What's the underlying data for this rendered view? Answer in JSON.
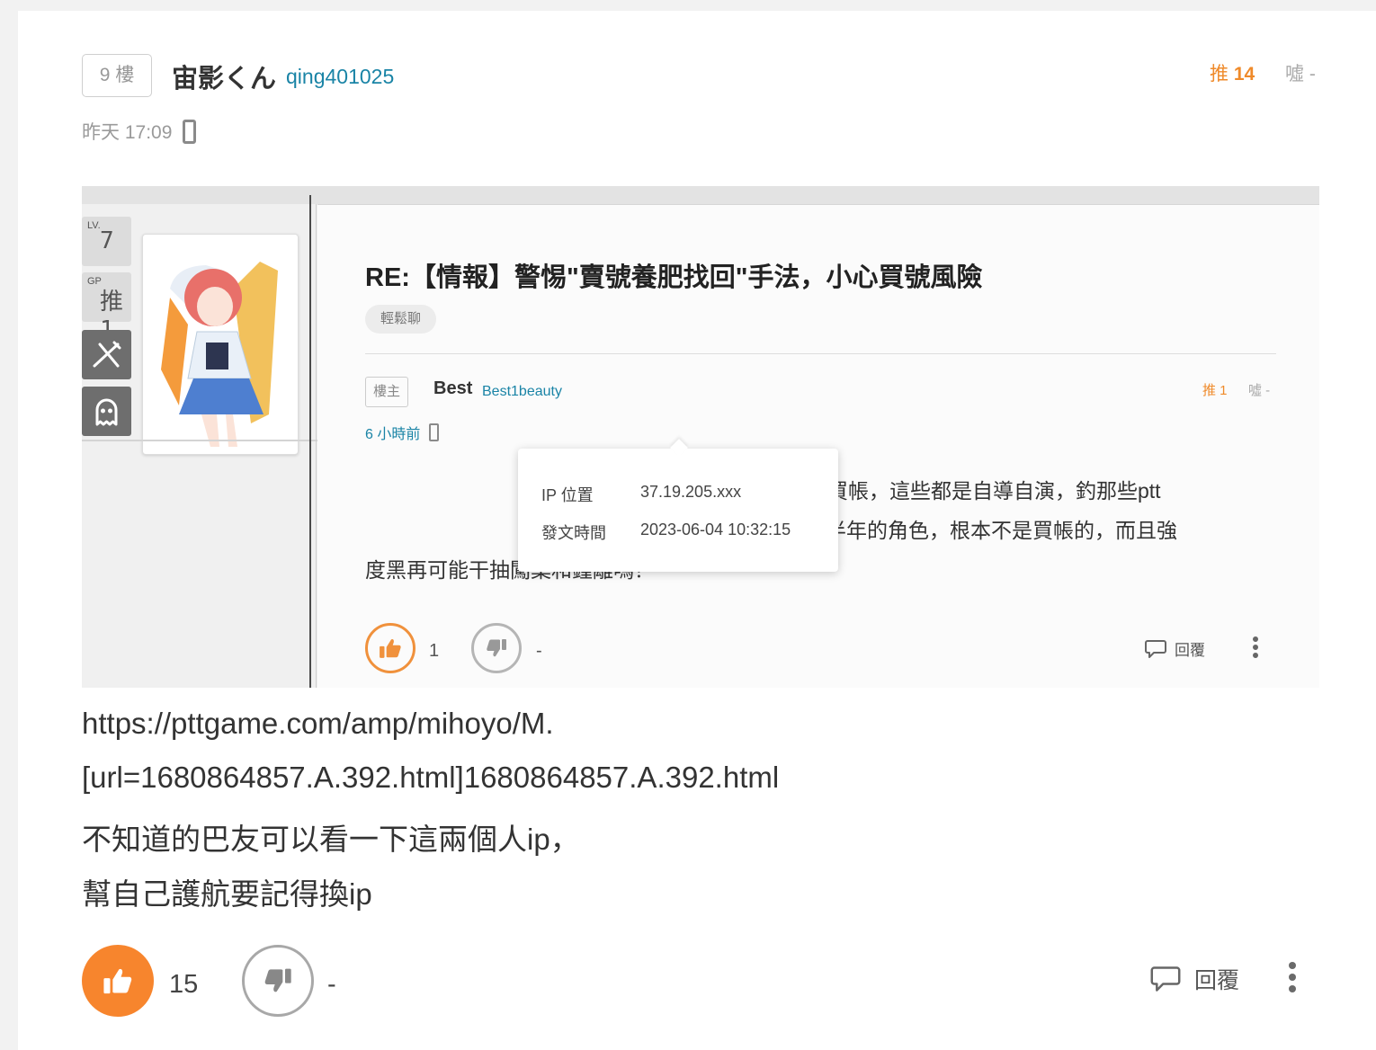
{
  "comment": {
    "floor": "9 樓",
    "username": "宙影くん",
    "user_id": "qing401025",
    "gp_label": "推",
    "gp_count": "14",
    "bp_label": "噓",
    "bp_count": "-",
    "time": "昨天 17:09",
    "device_icon": "mobile-phone-icon",
    "body_lines": [
      "https://pttgame.com/amp/mihoyo/M.",
      "[url=1680864857.A.392.html]1680864857.A.392.html",
      "不知道的巴友可以看一下這兩個人ip，",
      "幫自己護航要記得換ip"
    ],
    "like_count": "15",
    "dislike_count": "-",
    "reply_label": "回覆",
    "accent_color": "#f7852d"
  },
  "screenshot": {
    "level_label": "LV.",
    "level": "7",
    "gp_label": "GP",
    "gp": "推 1",
    "title": "RE:【情報】警惕\"賣號養肥找回\"手法，小心買號風險",
    "tag": "輕鬆聊",
    "badge": "樓主",
    "username": "Best",
    "user_id": "Best1beauty",
    "bp": "噓 -",
    "time": "6 小時前",
    "text_lines": [
      "已經說這是假的了，根本沒有買帳，這些都是自導自演，釣那些ptt",
      "且這一看他擁有的角色都是近半年的角色，根本不是買帳的，而且強",
      "度黑再可能干抽闖葉和鍾離嗎？"
    ],
    "tooltip": {
      "ip_label": "IP 位置",
      "ip_value": "37.19.205.xxx",
      "time_label": "發文時間",
      "time_value": "2023-06-04 10:32:15"
    },
    "like_count": "1",
    "dislike_count": "-",
    "reply_label": "回覆"
  }
}
